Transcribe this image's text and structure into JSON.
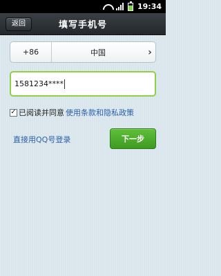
{
  "statusbar": {
    "time": "19:34"
  },
  "header": {
    "back_label": "返回",
    "title": "填写手机号"
  },
  "country_selector": {
    "code": "+86",
    "country": "中国",
    "chevron": "›"
  },
  "phone": {
    "value": "1581234****"
  },
  "agreement": {
    "checked": true,
    "check_mark": "✓",
    "prefix": "已阅读并同意",
    "link": "使用条款和隐私政策"
  },
  "qq_login": {
    "label": "直接用QQ号登录"
  },
  "next": {
    "label": "下一步"
  },
  "colors": {
    "accent_green": "#4fae2d",
    "link_blue": "#2a5fa7",
    "field_focus": "#8fd141"
  }
}
